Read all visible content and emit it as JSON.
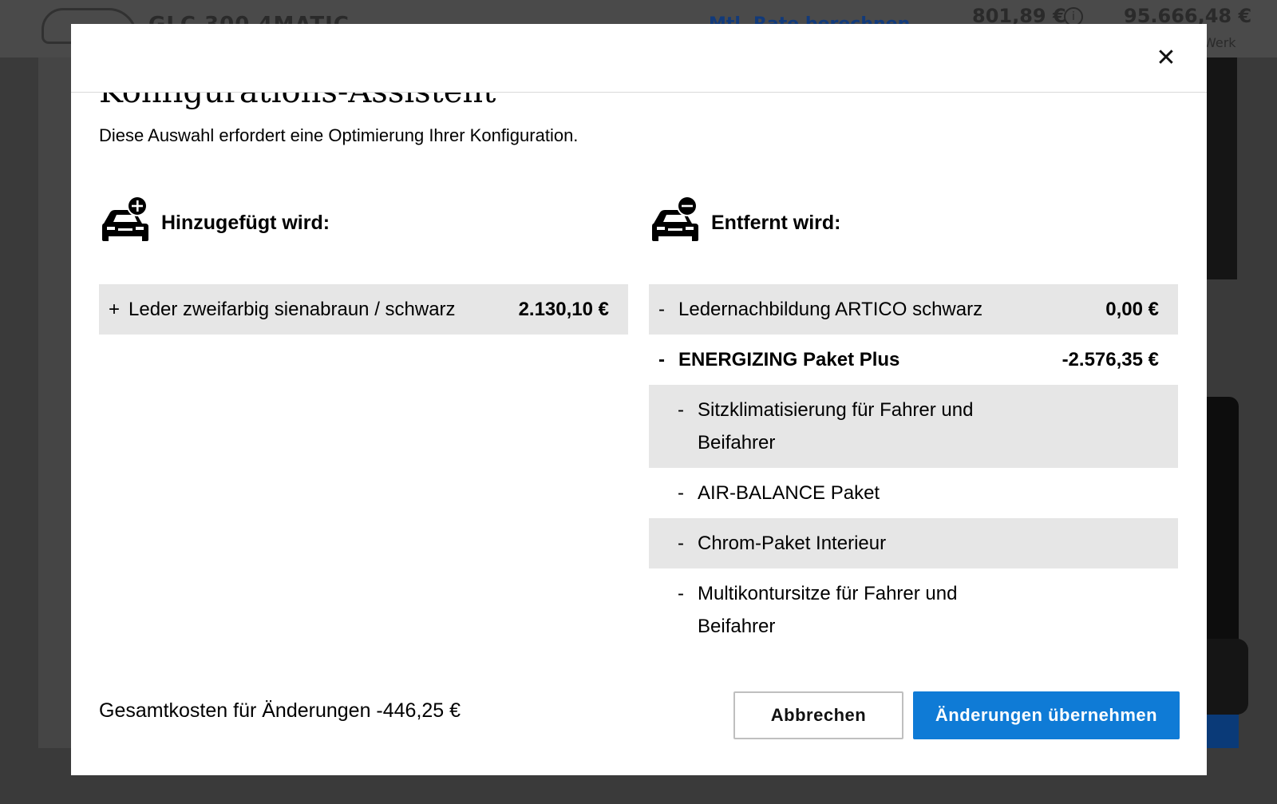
{
  "background": {
    "model_name": "GLC 300 4MATIC",
    "rate_link": "Mtl. Rate berechnen",
    "monthly_price": "801,89 €",
    "total_price": "95.666,48 €",
    "total_price_note": "Werk"
  },
  "modal": {
    "title": "Konfigurations-Assistent",
    "subtitle": "Diese Auswahl erfordert eine Optimierung Ihrer Konfiguration.",
    "close_icon": "close-icon",
    "added": {
      "header": "Hinzugefügt wird:",
      "icon": "car-plus-icon",
      "items": [
        {
          "sign": "+",
          "name": "Leder zweifarbig sienabraun / schwarz",
          "price": "2.130,10 €"
        }
      ]
    },
    "removed": {
      "header": "Entfernt wird:",
      "icon": "car-minus-icon",
      "items": [
        {
          "sign": "-",
          "name": "Ledernachbildung ARTICO schwarz",
          "price": "0,00 €"
        },
        {
          "sign": "-",
          "name": "ENERGIZING Paket Plus",
          "price": "-2.576,35 €"
        },
        {
          "sign": "-",
          "name": "Sitzklimatisierung für Fahrer und Beifahrer"
        },
        {
          "sign": "-",
          "name": "AIR-BALANCE Paket"
        },
        {
          "sign": "-",
          "name": "Chrom-Paket Interieur"
        },
        {
          "sign": "-",
          "name": "Multikontursitze für Fahrer und Beifahrer"
        }
      ]
    },
    "total_label": "Gesamtkosten für Änderungen -446,25 €",
    "cancel_label": "Abbrechen",
    "apply_label": "Änderungen übernehmen"
  },
  "colors": {
    "accent": "#0f7bd6",
    "row_shade": "#e6e6e6",
    "overlay": "#3a3a3a"
  }
}
